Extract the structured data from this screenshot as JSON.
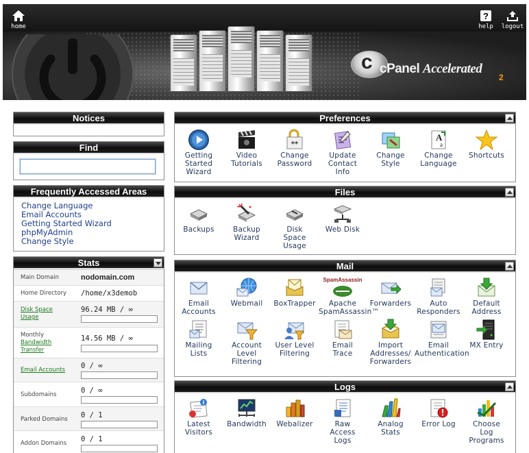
{
  "header": {
    "home_label": "home",
    "help_label": "help",
    "logout_label": "logout",
    "brand_c": "c",
    "brand_name": "cPanel",
    "brand_accent": "Accelerated",
    "brand_version": "2"
  },
  "notices": {
    "title": "Notices"
  },
  "find": {
    "title": "Find",
    "value": ""
  },
  "faa": {
    "title": "Frequently Accessed Areas",
    "links": [
      "Change Language",
      "Email Accounts",
      "Getting Started Wizard",
      "phpMyAdmin",
      "Change Style"
    ]
  },
  "stats": {
    "title": "Stats",
    "rows": [
      {
        "label": "Main Domain",
        "value": "nodomain.com"
      },
      {
        "label": "Home Directory",
        "value": "/home/x3demob"
      },
      {
        "label": "Disk Space Usage",
        "value": "96.24 MB / ∞"
      },
      {
        "label": "Monthly Bandwidth Transfer",
        "value": "14.56 MB / ∞"
      },
      {
        "label": "Email Accounts",
        "value": "0 / ∞"
      },
      {
        "label": "Subdomains",
        "value": "0 / ∞"
      },
      {
        "label": "Parked Domains",
        "value": "0 / 1"
      },
      {
        "label": "Addon Domains",
        "value": "0 / 1"
      }
    ]
  },
  "sections": {
    "preferences": {
      "title": "Preferences",
      "items": [
        "Getting\nStarted\nWizard",
        "Video\nTutorials",
        "Change\nPassword",
        "Update\nContact\nInfo",
        "Change\nStyle",
        "Change\nLanguage",
        "Shortcuts"
      ]
    },
    "files": {
      "title": "Files",
      "items": [
        "Backups",
        "Backup\nWizard",
        "Disk\nSpace\nUsage",
        "Web Disk"
      ]
    },
    "mail": {
      "title": "Mail",
      "spam_logo": "SpamAssassin",
      "items": [
        "Email\nAccounts",
        "Webmail",
        "BoxTrapper",
        "Apache\nSpamAssassin™",
        "Forwarders",
        "Auto\nResponders",
        "Default\nAddress",
        "Mailing\nLists",
        "Account\nLevel\nFiltering",
        "User Level\nFiltering",
        "Email\nTrace",
        "Import\nAddresses/\nForwarders",
        "Email\nAuthentication",
        "MX Entry"
      ]
    },
    "logs": {
      "title": "Logs",
      "items": [
        "Latest\nVisitors",
        "Bandwidth",
        "Webalizer",
        "Raw\nAccess\nLogs",
        "Analog\nStats",
        "Error Log",
        "Choose\nLog\nPrograms"
      ]
    }
  }
}
